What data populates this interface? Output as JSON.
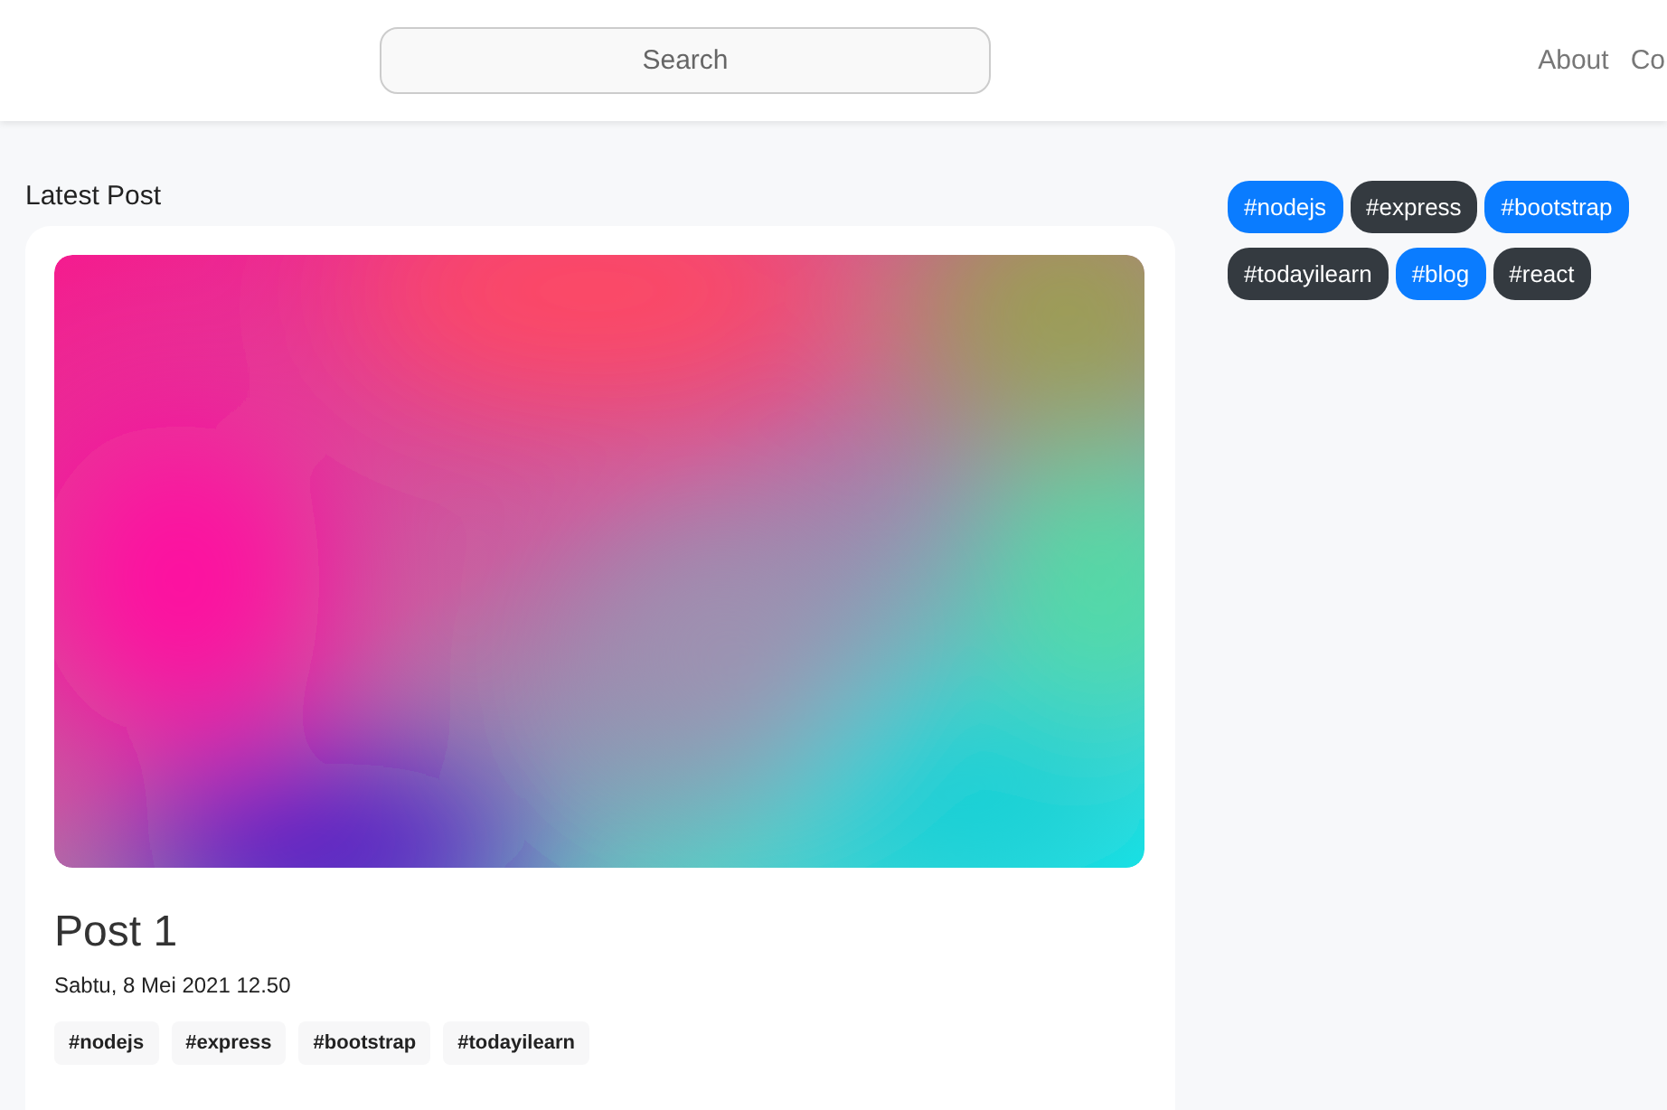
{
  "header": {
    "search": {
      "placeholder": "Search"
    },
    "nav": [
      {
        "label": "About"
      },
      {
        "label": "Co"
      }
    ]
  },
  "section_title": "Latest Post",
  "post": {
    "title": "Post 1",
    "date": "Sabtu, 8 Mei 2021 12.50",
    "tags": [
      "#nodejs",
      "#express",
      "#bootstrap",
      "#todayilearn"
    ]
  },
  "tag_cloud": [
    {
      "label": "#nodejs",
      "color": "#0a7cff"
    },
    {
      "label": "#express",
      "color": "#343a40"
    },
    {
      "label": "#bootstrap",
      "color": "#0a7cff"
    },
    {
      "label": "#todayilearn",
      "color": "#343a40"
    },
    {
      "label": "#blog",
      "color": "#0a7cff"
    },
    {
      "label": "#react",
      "color": "#343a40"
    }
  ]
}
